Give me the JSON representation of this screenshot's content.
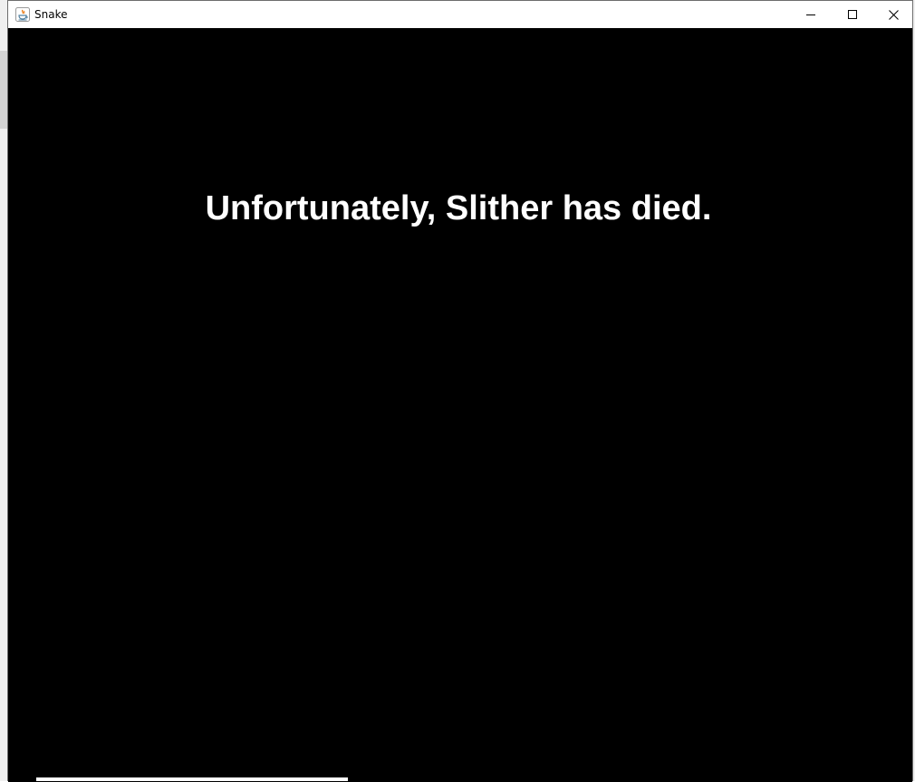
{
  "window": {
    "title": "Snake",
    "app_icon": "java-icon",
    "controls": {
      "minimize": "minimize-icon",
      "maximize": "maximize-icon",
      "close": "close-icon"
    }
  },
  "game": {
    "message": "Unfortunately, Slither has died.",
    "background_color": "#000000",
    "text_color": "#ffffff"
  }
}
